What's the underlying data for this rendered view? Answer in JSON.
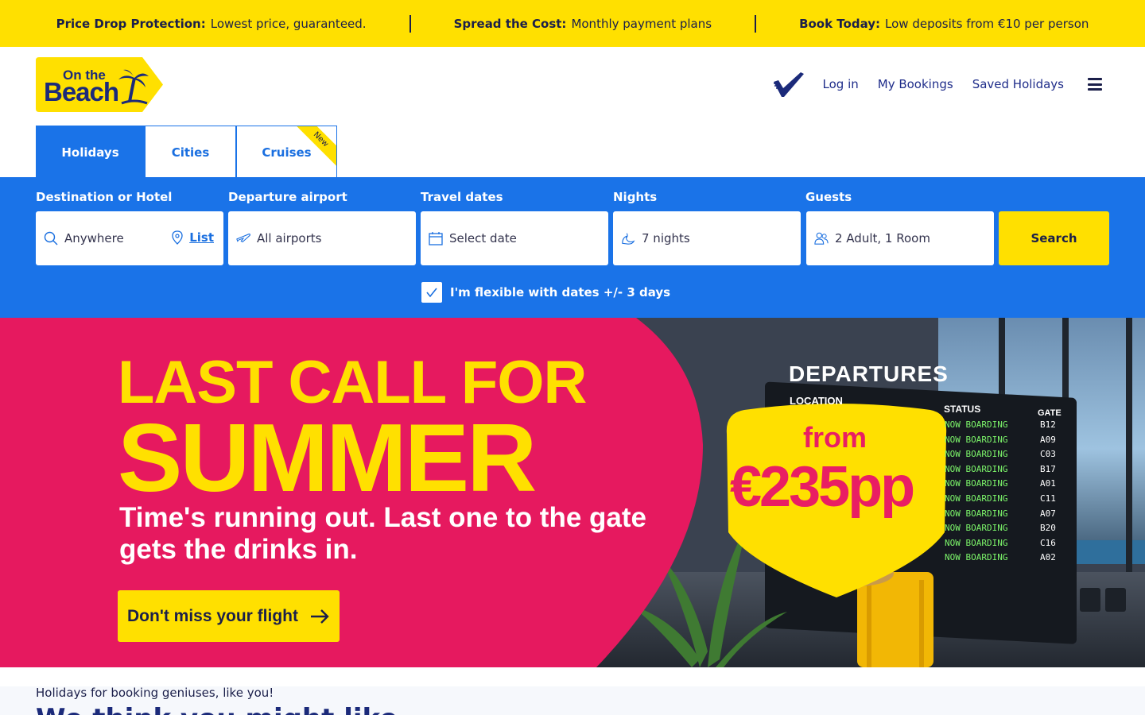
{
  "promo_bar": {
    "items": [
      {
        "bold": "Price Drop Protection:",
        "text": "Lowest price, guaranteed."
      },
      {
        "bold": "Spread the Cost:",
        "text": "Monthly payment plans"
      },
      {
        "bold": "Book Today:",
        "text": "Low deposits from €10 per person"
      }
    ]
  },
  "header": {
    "logo_text_top": "On the",
    "logo_text_bottom": "Beach",
    "nav": {
      "login": "Log in",
      "bookings": "My Bookings",
      "saved": "Saved Holidays"
    }
  },
  "tabs": [
    {
      "label": "Holidays",
      "active": true
    },
    {
      "label": "Cities",
      "active": false
    },
    {
      "label": "Cruises",
      "active": false,
      "badge": "New"
    }
  ],
  "search": {
    "destination": {
      "label": "Destination or Hotel",
      "value": "Anywhere",
      "list_link": "List"
    },
    "departure": {
      "label": "Departure airport",
      "value": "All airports"
    },
    "dates": {
      "label": "Travel dates",
      "value": "Select date"
    },
    "nights": {
      "label": "Nights",
      "value": "7 nights"
    },
    "guests": {
      "label": "Guests",
      "value": "2 Adult, 1 Room"
    },
    "button": "Search",
    "flexible": {
      "label": "I'm flexible with dates +/- 3 days",
      "checked": true
    }
  },
  "hero": {
    "title_line1": "LAST CALL FOR",
    "title_line2": "SUMMER",
    "subtitle": "Time's running out. Last one to the gate gets the drinks in.",
    "cta": "Don't miss your flight",
    "price_from": "from",
    "price_value": "€235pp",
    "board": {
      "title": "DEPARTURES",
      "location": "LOCATION",
      "status_header": "STATUS",
      "gate_header": "GATE",
      "rows": [
        {
          "status": "NOW BOARDING",
          "gate": "B12"
        },
        {
          "status": "NOW BOARDING",
          "gate": "A09"
        },
        {
          "status": "NOW BOARDING",
          "gate": "C03"
        },
        {
          "status": "NOW BOARDING",
          "gate": "B17"
        },
        {
          "status": "NOW BOARDING",
          "gate": "A01"
        },
        {
          "status": "NOW BOARDING",
          "gate": "C11"
        },
        {
          "status": "NOW BOARDING",
          "gate": "A07"
        },
        {
          "status": "NOW BOARDING",
          "gate": "B20"
        },
        {
          "status": "NOW BOARDING",
          "gate": "C16"
        },
        {
          "status": "NOW BOARDING",
          "gate": "A02"
        }
      ]
    }
  },
  "below": {
    "kicker": "Holidays for booking geniuses, like you!",
    "heading": "We think you might like"
  },
  "colors": {
    "brand_yellow": "#ffe000",
    "brand_blue": "#1a73e8",
    "navy": "#1b1f4a",
    "hero_pink": "#e6195f"
  }
}
